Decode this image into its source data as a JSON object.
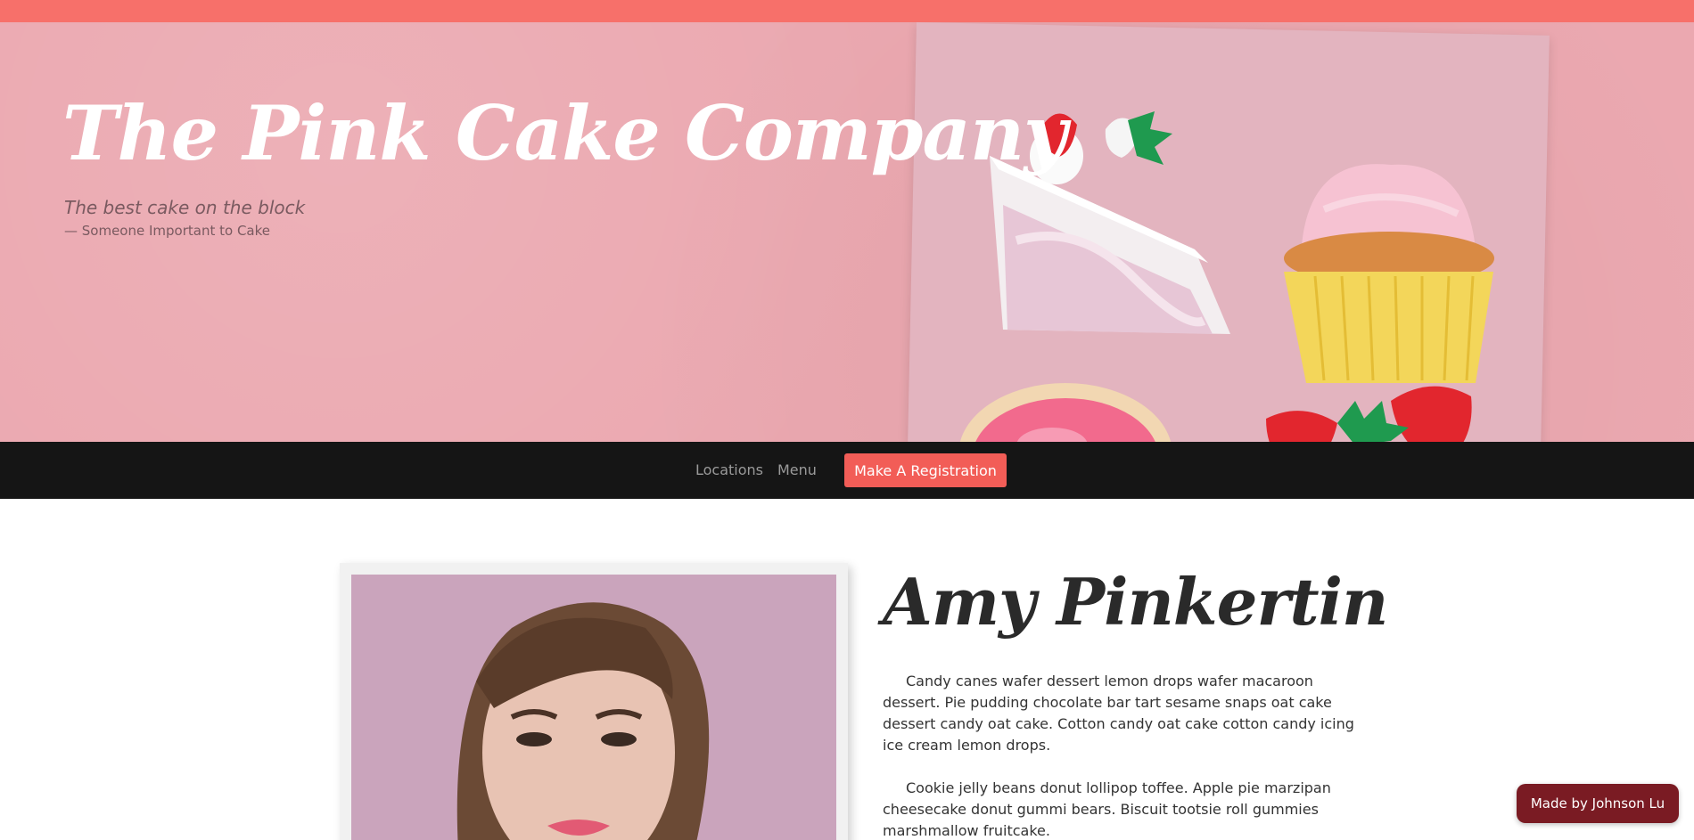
{
  "hero": {
    "title": "The Pink Cake Company",
    "quote": "The best cake on the block",
    "cite": "— Someone Important to Cake"
  },
  "nav": {
    "links": [
      "Locations",
      "Menu"
    ],
    "cta": "Make A Registration"
  },
  "profile": {
    "name": "Amy Pinkertin",
    "paragraphs": [
      "Candy canes wafer dessert lemon drops wafer macaroon dessert. Pie pudding chocolate bar tart sesame snaps oat cake dessert candy oat cake. Cotton candy oat cake cotton candy icing ice cream lemon drops.",
      "Cookie jelly beans donut lollipop toffee. Apple pie marzipan cheesecake donut gummi bears. Biscuit tootsie roll gummies marshmallow fruitcake."
    ]
  },
  "badge": {
    "label": "Made by Johnson Lu"
  },
  "colors": {
    "accent": "#f7706a",
    "hero_bg": "#eba8b0",
    "nav_bg": "#151515",
    "cta_bg": "#f25d57",
    "badge_bg": "#7a1b23"
  }
}
